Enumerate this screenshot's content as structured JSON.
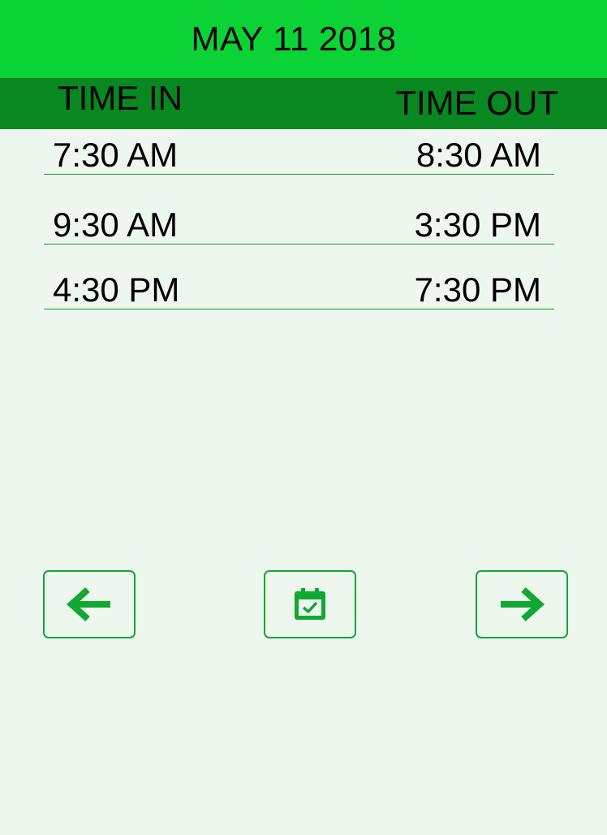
{
  "header": {
    "date": "MAY 11 2018"
  },
  "columns": {
    "time_in": "TIME IN",
    "time_out": "TIME OUT"
  },
  "rows": [
    {
      "time_in": "7:30 AM",
      "time_out": "8:30 AM"
    },
    {
      "time_in": "9:30 AM",
      "time_out": "3:30 PM"
    },
    {
      "time_in": "4:30 PM",
      "time_out": "7:30 PM"
    }
  ],
  "nav": {
    "prev_icon": "arrow-left-icon",
    "calendar_icon": "calendar-check-icon",
    "next_icon": "arrow-right-icon"
  },
  "colors": {
    "header": "#0bd335",
    "subheader": "#098720",
    "background": "#edf7ee",
    "accent": "#11a833"
  }
}
